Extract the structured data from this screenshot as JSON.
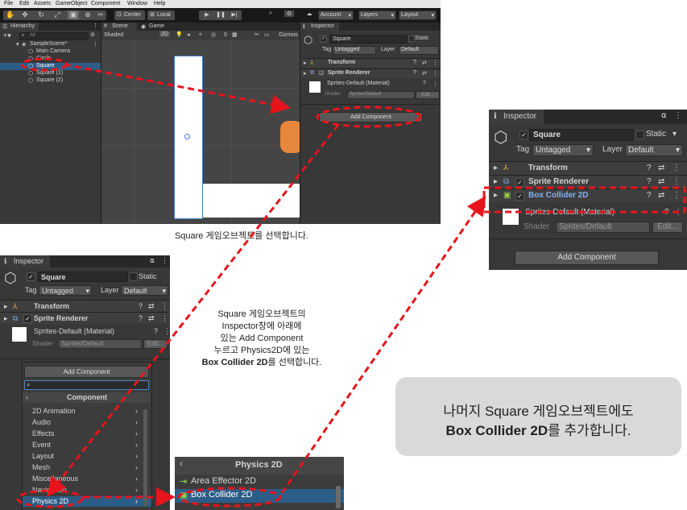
{
  "editor": {
    "menu": [
      "File",
      "Edit",
      "Assets",
      "GameObject",
      "Component",
      "Window",
      "Help"
    ],
    "toolbar": {
      "center": "Center",
      "local": "Local",
      "account": "Account",
      "layers": "Layers",
      "layout": "Layout"
    },
    "hierarchy": {
      "title": "Hierarchy",
      "search_placeholder": "All",
      "items": [
        "SampleScene*",
        "Main Camera",
        "Circle",
        "Square",
        "Square (1)",
        "Square (2)"
      ]
    },
    "scene": {
      "tab_scene": "Scene",
      "tab_game": "Game",
      "shading": "Shaded",
      "mode2d": "2D",
      "gizmos": "Gizmos",
      "zero": "0"
    },
    "inspector": {
      "title": "Inspector",
      "object_name": "Square",
      "static": "Static",
      "tag_label": "Tag",
      "tag_value": "Untagged",
      "layer_label": "Layer",
      "layer_value": "Default",
      "transform": "Transform",
      "sprite_renderer": "Sprite Renderer",
      "material": "Sprites-Default (Material)",
      "shader_label": "Shader",
      "shader_value": "Sprites/Default",
      "edit": "Edit...",
      "add_component": "Add Component"
    }
  },
  "caption1": "Square 게임오브젝트를  선택합니다.",
  "inspector2": {
    "title": "Inspector",
    "object_name": "Square",
    "static": "Static",
    "tag_label": "Tag",
    "tag_value": "Untagged",
    "layer_label": "Layer",
    "layer_value": "Default",
    "transform": "Transform",
    "sprite_renderer": "Sprite Renderer",
    "material": "Sprites-Default (Material)",
    "shader_label": "Shader",
    "shader_value": "Sprites/Default",
    "edit": "Edit...",
    "add_component": "Add Component",
    "component_header": "Component",
    "components": [
      "2D Animation",
      "Audio",
      "Effects",
      "Event",
      "Layout",
      "Mesh",
      "Miscellaneous",
      "Navigation",
      "Physics 2D"
    ]
  },
  "caption2": {
    "line1": "Square 게임오브젝트의",
    "line2": "Inspector창에 아래에",
    "line3": "있는 Add Component",
    "line4": "누르고 Physics2D에  있는",
    "line5_bold": "Box Collider 2D",
    "line5_rest": "를 선택합니다."
  },
  "physics": {
    "title": "Physics 2D",
    "items": [
      "Area Effector 2D",
      "Box Collider 2D"
    ]
  },
  "inspector3": {
    "title": "Inspector",
    "object_name": "Square",
    "static": "Static",
    "tag_label": "Tag",
    "tag_value": "Untagged",
    "layer_label": "Layer",
    "layer_value": "Default",
    "transform": "Transform",
    "sprite_renderer": "Sprite Renderer",
    "box_collider": "Box Collider 2D",
    "material": "Sprites-Default (Material)",
    "shader_label": "Shader",
    "shader_value": "Sprites/Default",
    "edit": "Edit...",
    "add_component": "Add Component"
  },
  "note": {
    "line1": "나머지 Square 게임오브젝트에도",
    "line2_bold": "Box Collider 2D",
    "line2_rest": "를 추가합니다."
  },
  "colors": {
    "annotation": "#e8141c",
    "selected": "#2c5d87",
    "unity_panel": "#383838",
    "note_bg": "#d9d9d9"
  }
}
